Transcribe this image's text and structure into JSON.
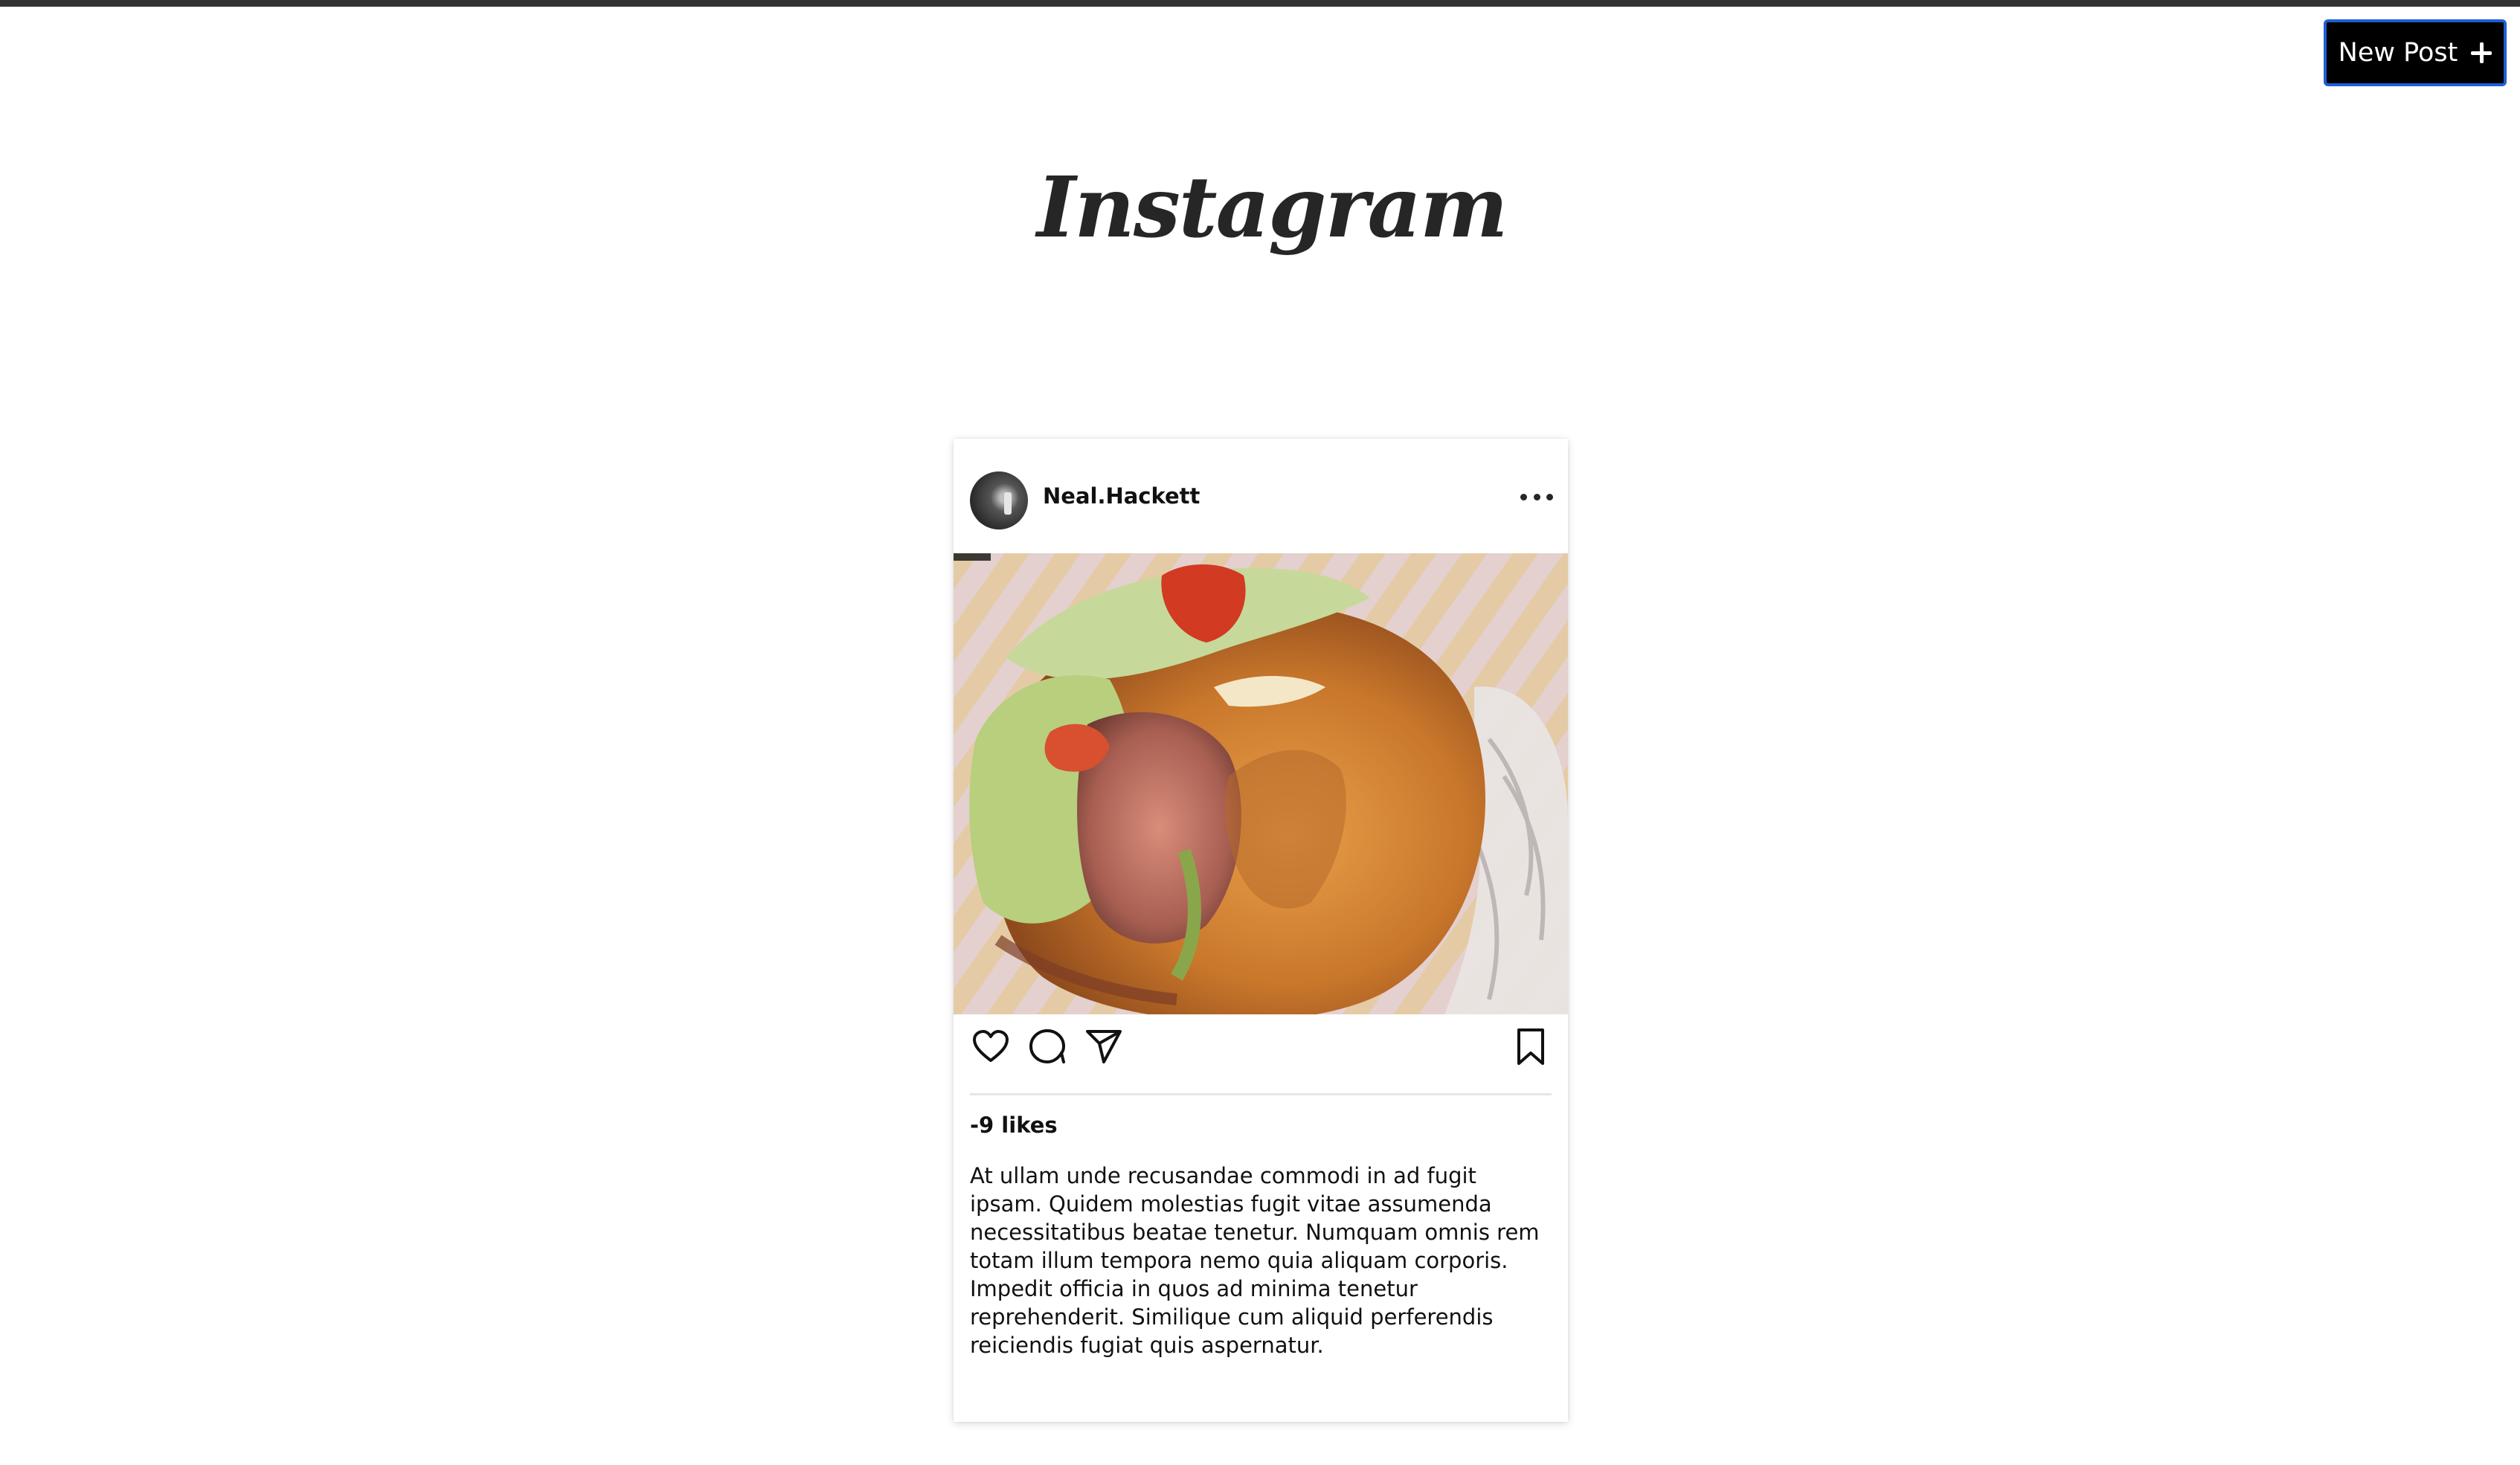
{
  "header": {
    "new_post_label": "New Post",
    "new_post_icon": "plus-icon",
    "logo_text": "Instagram"
  },
  "post": {
    "username": "Neal.Hackett",
    "more_icon": "more-horizontal-icon",
    "image_description_icon": "post-photo",
    "likes_text": "-9 likes",
    "caption": "At ullam unde recusandae commodi in ad fugit ipsam. Quidem molestias fugit vitae assumenda necessitatibus beatae tenetur. Numquam omnis rem totam illum tempora nemo quia aliquam corporis. Impedit officia in quos ad minima tenetur reprehenderit. Similique cum aliquid perferendis reiciendis fugiat quis aspernatur.",
    "actions": {
      "like_icon": "heart-icon",
      "comment_icon": "comment-icon",
      "share_icon": "send-icon",
      "save_icon": "bookmark-icon"
    }
  },
  "colors": {
    "top_bar": "#333333",
    "button_bg": "#000000",
    "button_border": "#1f5fd6",
    "text": "#111111"
  }
}
